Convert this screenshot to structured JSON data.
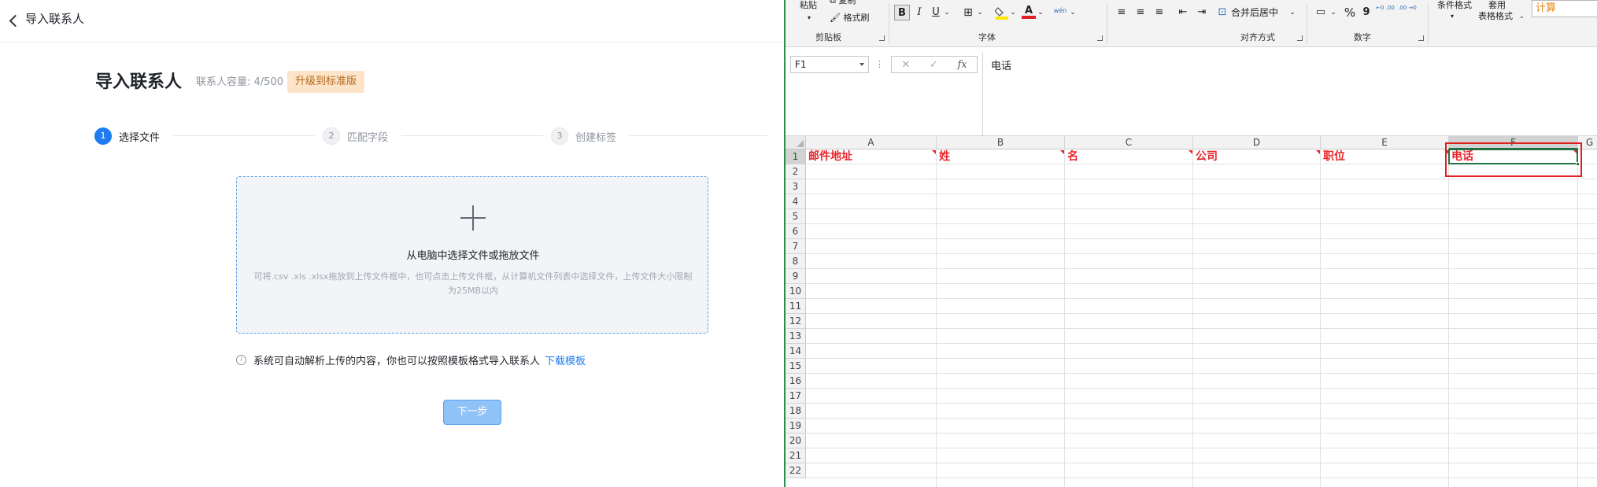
{
  "import_page": {
    "top_title": "导入联系人",
    "page_title": "导入联系人",
    "capacity_text": "联系人容量: 4/500",
    "upgrade_label": "升级到标准版",
    "steps": [
      {
        "num": "1",
        "label": "选择文件",
        "state": "active"
      },
      {
        "num": "2",
        "label": "匹配字段",
        "state": "inactive"
      },
      {
        "num": "3",
        "label": "创建标签",
        "state": "inactive"
      }
    ],
    "dropzone": {
      "title": "从电脑中选择文件或拖放文件",
      "hint": "可将.csv .xls .xlsx拖放到上传文件框中，也可点击上传文件框，从计算机文件列表中选择文件，上传文件大小限制为25MB以内"
    },
    "info_text": "系统可自动解析上传的内容，你也可以按照模板格式导入联系人",
    "info_icon_glyph": "i",
    "download_link": "下载模板",
    "next_label": "下一步",
    "accent_color": "#1f7cf0"
  },
  "excel": {
    "ribbon": {
      "paste": "粘贴",
      "copy": "复制",
      "format_painter": "格式刷",
      "clipboard_group": "剪贴板",
      "font_group": "字体",
      "alignment_group": "对齐方式",
      "number_group": "数字",
      "bold": "B",
      "italic": "I",
      "underline": "U",
      "font_color_glyph": "A",
      "wen_glyph": "wén",
      "merge_center": "合并后居中",
      "percent": "%",
      "comma": "9",
      "inc_decimal": "←0 .00",
      "dec_decimal": ".00 →0",
      "conditional_format": "条件格式",
      "table_format_1": "套用",
      "table_format_2": "表格格式",
      "style_cell": "计算"
    },
    "name_box": "F1",
    "fx_cancel": "✕",
    "fx_confirm": "✓",
    "fx_label": "fx",
    "formula_value": "电话",
    "columns": [
      "A",
      "B",
      "C",
      "D",
      "E",
      "F",
      "G"
    ],
    "rows": [
      "1",
      "2",
      "3",
      "4",
      "5",
      "6",
      "7",
      "8",
      "9",
      "10",
      "11",
      "12",
      "13",
      "14",
      "15",
      "16",
      "17",
      "18",
      "19",
      "20",
      "21",
      "22"
    ],
    "row1_cells": [
      "邮件地址",
      "姓",
      "名",
      "公司",
      "职位",
      "电话"
    ],
    "header_color": "#e8242a",
    "highlight_color": "#e02020"
  }
}
